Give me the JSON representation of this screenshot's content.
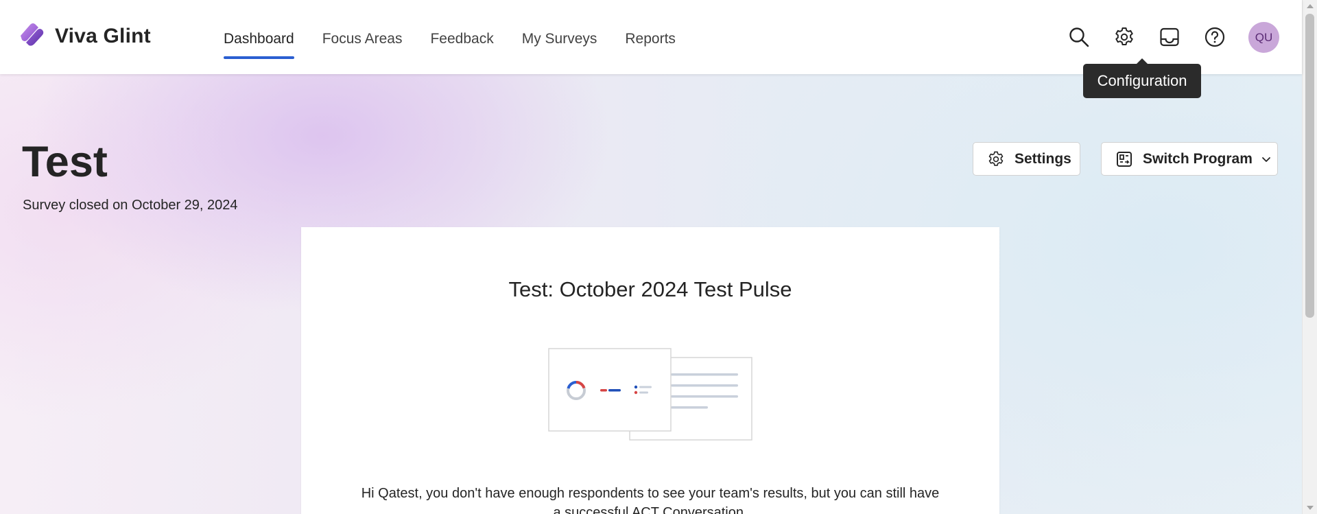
{
  "header": {
    "brand": "Viva Glint",
    "nav": [
      {
        "label": "Dashboard",
        "active": true
      },
      {
        "label": "Focus Areas",
        "active": false
      },
      {
        "label": "Feedback",
        "active": false
      },
      {
        "label": "My Surveys",
        "active": false
      },
      {
        "label": "Reports",
        "active": false
      }
    ],
    "icons": [
      "search-icon",
      "gear-icon",
      "inbox-icon",
      "help-icon"
    ],
    "avatar_initials": "QU",
    "tooltip": "Configuration",
    "accent_color": "#2b5fd1"
  },
  "page": {
    "title": "Test",
    "subtitle": "Survey closed on October 29, 2024",
    "settings_button": "Settings",
    "switch_program_button": "Switch Program"
  },
  "card": {
    "title": "Test: October 2024 Test Pulse",
    "message": "Hi Qatest, you don't have enough respondents to see your team's results, but you can still have a successful ACT Conversation."
  }
}
